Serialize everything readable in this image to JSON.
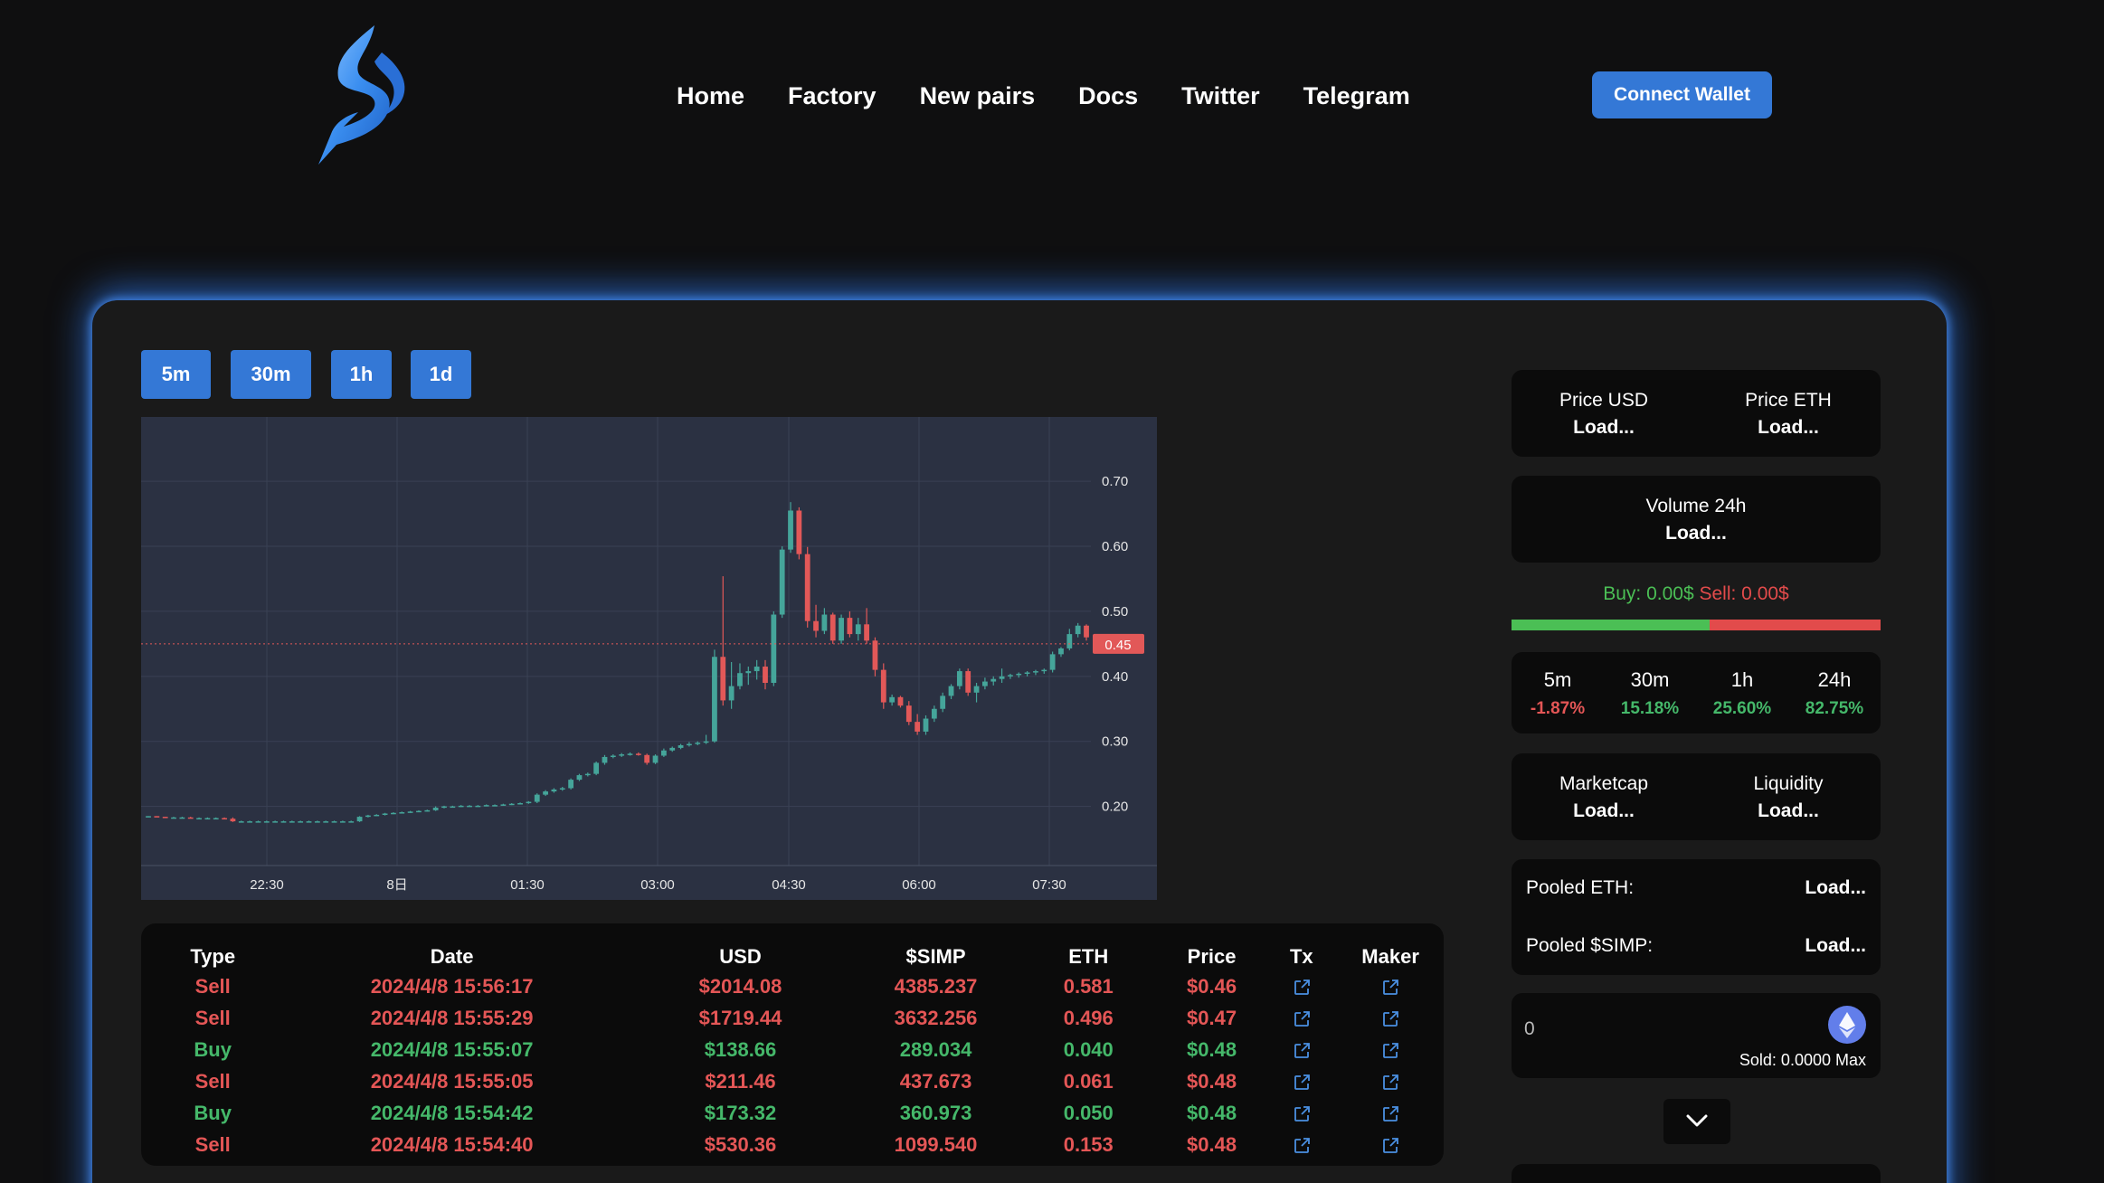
{
  "nav": {
    "items": [
      "Home",
      "Factory",
      "New pairs",
      "Docs",
      "Twitter",
      "Telegram"
    ],
    "connect_label": "Connect Wallet"
  },
  "timeframes": [
    "5m",
    "30m",
    "1h",
    "1d"
  ],
  "chart_data": {
    "type": "candlestick",
    "x_tick_labels": [
      "22:30",
      "8日",
      "01:30",
      "03:00",
      "04:30",
      "06:00",
      "07:30"
    ],
    "y_ticks": [
      0.2,
      0.3,
      0.4,
      0.5,
      0.6,
      0.7
    ],
    "y_tick_labels": [
      "0.20",
      "0.30",
      "0.40",
      "0.50",
      "0.60",
      "0.70"
    ],
    "ylim": [
      0.109,
      0.799
    ],
    "current_price": 0.45,
    "current_price_label": "0.45",
    "candles": [
      [
        0.185,
        0.185,
        0.184,
        0.185
      ],
      [
        0.185,
        0.185,
        0.184,
        0.184
      ],
      [
        0.184,
        0.184,
        0.183,
        0.183
      ],
      [
        0.183,
        0.184,
        0.182,
        0.183
      ],
      [
        0.183,
        0.184,
        0.182,
        0.183
      ],
      [
        0.183,
        0.184,
        0.182,
        0.182
      ],
      [
        0.182,
        0.183,
        0.181,
        0.182
      ],
      [
        0.182,
        0.183,
        0.181,
        0.182
      ],
      [
        0.182,
        0.183,
        0.181,
        0.182
      ],
      [
        0.182,
        0.183,
        0.181,
        0.181
      ],
      [
        0.181,
        0.183,
        0.176,
        0.177
      ],
      [
        0.177,
        0.178,
        0.176,
        0.177
      ],
      [
        0.177,
        0.178,
        0.176,
        0.177
      ],
      [
        0.177,
        0.178,
        0.176,
        0.177
      ],
      [
        0.177,
        0.178,
        0.176,
        0.177
      ],
      [
        0.177,
        0.178,
        0.176,
        0.177
      ],
      [
        0.177,
        0.178,
        0.176,
        0.177
      ],
      [
        0.177,
        0.178,
        0.176,
        0.177
      ],
      [
        0.177,
        0.178,
        0.176,
        0.177
      ],
      [
        0.177,
        0.178,
        0.176,
        0.177
      ],
      [
        0.177,
        0.178,
        0.176,
        0.177
      ],
      [
        0.177,
        0.178,
        0.176,
        0.177
      ],
      [
        0.177,
        0.178,
        0.176,
        0.177
      ],
      [
        0.177,
        0.178,
        0.176,
        0.177
      ],
      [
        0.177,
        0.178,
        0.176,
        0.177
      ],
      [
        0.177,
        0.185,
        0.176,
        0.184
      ],
      [
        0.184,
        0.187,
        0.183,
        0.186
      ],
      [
        0.186,
        0.188,
        0.185,
        0.187
      ],
      [
        0.187,
        0.19,
        0.186,
        0.189
      ],
      [
        0.189,
        0.191,
        0.188,
        0.19
      ],
      [
        0.19,
        0.192,
        0.189,
        0.191
      ],
      [
        0.191,
        0.193,
        0.19,
        0.192
      ],
      [
        0.192,
        0.194,
        0.191,
        0.193
      ],
      [
        0.193,
        0.195,
        0.192,
        0.194
      ],
      [
        0.194,
        0.2,
        0.193,
        0.198
      ],
      [
        0.198,
        0.201,
        0.197,
        0.2
      ],
      [
        0.2,
        0.201,
        0.199,
        0.2
      ],
      [
        0.2,
        0.202,
        0.199,
        0.201
      ],
      [
        0.201,
        0.202,
        0.2,
        0.201
      ],
      [
        0.201,
        0.202,
        0.2,
        0.201
      ],
      [
        0.201,
        0.203,
        0.2,
        0.202
      ],
      [
        0.202,
        0.203,
        0.201,
        0.202
      ],
      [
        0.202,
        0.204,
        0.201,
        0.203
      ],
      [
        0.203,
        0.205,
        0.202,
        0.204
      ],
      [
        0.204,
        0.206,
        0.203,
        0.205
      ],
      [
        0.205,
        0.208,
        0.204,
        0.207
      ],
      [
        0.207,
        0.22,
        0.205,
        0.218
      ],
      [
        0.218,
        0.225,
        0.216,
        0.223
      ],
      [
        0.223,
        0.228,
        0.221,
        0.226
      ],
      [
        0.226,
        0.23,
        0.224,
        0.228
      ],
      [
        0.228,
        0.243,
        0.226,
        0.241
      ],
      [
        0.241,
        0.25,
        0.239,
        0.248
      ],
      [
        0.248,
        0.252,
        0.246,
        0.25
      ],
      [
        0.25,
        0.269,
        0.248,
        0.267
      ],
      [
        0.267,
        0.279,
        0.264,
        0.276
      ],
      [
        0.276,
        0.28,
        0.274,
        0.278
      ],
      [
        0.278,
        0.282,
        0.276,
        0.28
      ],
      [
        0.28,
        0.283,
        0.278,
        0.281
      ],
      [
        0.281,
        0.283,
        0.278,
        0.279
      ],
      [
        0.279,
        0.281,
        0.264,
        0.267
      ],
      [
        0.267,
        0.28,
        0.265,
        0.278
      ],
      [
        0.278,
        0.289,
        0.276,
        0.286
      ],
      [
        0.286,
        0.292,
        0.284,
        0.29
      ],
      [
        0.29,
        0.296,
        0.288,
        0.294
      ],
      [
        0.294,
        0.299,
        0.292,
        0.296
      ],
      [
        0.296,
        0.3,
        0.294,
        0.298
      ],
      [
        0.298,
        0.31,
        0.296,
        0.3
      ],
      [
        0.3,
        0.441,
        0.298,
        0.43
      ],
      [
        0.43,
        0.554,
        0.355,
        0.363
      ],
      [
        0.363,
        0.422,
        0.35,
        0.385
      ],
      [
        0.385,
        0.42,
        0.38,
        0.405
      ],
      [
        0.405,
        0.415,
        0.387,
        0.408
      ],
      [
        0.408,
        0.425,
        0.395,
        0.415
      ],
      [
        0.415,
        0.425,
        0.38,
        0.39
      ],
      [
        0.39,
        0.5,
        0.385,
        0.495
      ],
      [
        0.495,
        0.6,
        0.49,
        0.595
      ],
      [
        0.595,
        0.668,
        0.59,
        0.655
      ],
      [
        0.655,
        0.66,
        0.58,
        0.588
      ],
      [
        0.588,
        0.599,
        0.475,
        0.485
      ],
      [
        0.485,
        0.51,
        0.46,
        0.47
      ],
      [
        0.47,
        0.505,
        0.465,
        0.495
      ],
      [
        0.495,
        0.498,
        0.45,
        0.455
      ],
      [
        0.455,
        0.495,
        0.45,
        0.49
      ],
      [
        0.49,
        0.5,
        0.46,
        0.465
      ],
      [
        0.465,
        0.49,
        0.455,
        0.48
      ],
      [
        0.48,
        0.505,
        0.45,
        0.455
      ],
      [
        0.455,
        0.46,
        0.4,
        0.41
      ],
      [
        0.41,
        0.42,
        0.35,
        0.36
      ],
      [
        0.36,
        0.372,
        0.355,
        0.368
      ],
      [
        0.368,
        0.37,
        0.352,
        0.355
      ],
      [
        0.355,
        0.362,
        0.325,
        0.33
      ],
      [
        0.33,
        0.342,
        0.31,
        0.315
      ],
      [
        0.315,
        0.34,
        0.31,
        0.335
      ],
      [
        0.335,
        0.355,
        0.33,
        0.35
      ],
      [
        0.35,
        0.375,
        0.345,
        0.37
      ],
      [
        0.37,
        0.388,
        0.365,
        0.385
      ],
      [
        0.385,
        0.412,
        0.38,
        0.408
      ],
      [
        0.408,
        0.412,
        0.37,
        0.375
      ],
      [
        0.375,
        0.39,
        0.36,
        0.385
      ],
      [
        0.385,
        0.398,
        0.38,
        0.392
      ],
      [
        0.392,
        0.4,
        0.386,
        0.396
      ],
      [
        0.396,
        0.412,
        0.39,
        0.4
      ],
      [
        0.4,
        0.404,
        0.396,
        0.402
      ],
      [
        0.402,
        0.406,
        0.398,
        0.404
      ],
      [
        0.404,
        0.408,
        0.4,
        0.406
      ],
      [
        0.406,
        0.41,
        0.402,
        0.408
      ],
      [
        0.408,
        0.412,
        0.404,
        0.41
      ],
      [
        0.41,
        0.438,
        0.406,
        0.434
      ],
      [
        0.434,
        0.445,
        0.43,
        0.443
      ],
      [
        0.443,
        0.473,
        0.44,
        0.465
      ],
      [
        0.465,
        0.482,
        0.46,
        0.478
      ],
      [
        0.478,
        0.48,
        0.455,
        0.46
      ]
    ]
  },
  "trades": {
    "headers": [
      "Type",
      "Date",
      "USD",
      "$SIMP",
      "ETH",
      "Price",
      "Tx",
      "Maker"
    ],
    "rows": [
      {
        "type": "Sell",
        "date": "2024/4/8 15:56:17",
        "usd": "$2014.08",
        "simp": "4385.237",
        "eth": "0.581",
        "price": "$0.46"
      },
      {
        "type": "Sell",
        "date": "2024/4/8 15:55:29",
        "usd": "$1719.44",
        "simp": "3632.256",
        "eth": "0.496",
        "price": "$0.47"
      },
      {
        "type": "Buy",
        "date": "2024/4/8 15:55:07",
        "usd": "$138.66",
        "simp": "289.034",
        "eth": "0.040",
        "price": "$0.48"
      },
      {
        "type": "Sell",
        "date": "2024/4/8 15:55:05",
        "usd": "$211.46",
        "simp": "437.673",
        "eth": "0.061",
        "price": "$0.48"
      },
      {
        "type": "Buy",
        "date": "2024/4/8 15:54:42",
        "usd": "$173.32",
        "simp": "360.973",
        "eth": "0.050",
        "price": "$0.48"
      },
      {
        "type": "Sell",
        "date": "2024/4/8 15:54:40",
        "usd": "$530.36",
        "simp": "1099.540",
        "eth": "0.153",
        "price": "$0.48"
      }
    ]
  },
  "stats": {
    "price_usd_label": "Price USD",
    "price_usd_value": "Load...",
    "price_eth_label": "Price ETH",
    "price_eth_value": "Load...",
    "volume_label": "Volume 24h",
    "volume_value": "Load...",
    "buy_text": "Buy: 0.00$",
    "sell_text": "Sell: 0.00$",
    "buy_ratio": 0.537,
    "changes": [
      {
        "label": "5m",
        "value": "-1.87%",
        "sign": "neg"
      },
      {
        "label": "30m",
        "value": "15.18%",
        "sign": "pos"
      },
      {
        "label": "1h",
        "value": "25.60%",
        "sign": "pos"
      },
      {
        "label": "24h",
        "value": "82.75%",
        "sign": "pos"
      }
    ],
    "marketcap_label": "Marketcap",
    "marketcap_value": "Load...",
    "liquidity_label": "Liquidity",
    "liquidity_value": "Load...",
    "pooled_eth_label": "Pooled ETH:",
    "pooled_eth_value": "Load...",
    "pooled_simp_label": "Pooled $SIMP:",
    "pooled_simp_value": "Load..."
  },
  "swap": {
    "input_value": "0",
    "sold_text": "Sold: 0.0000 Max"
  },
  "colors": {
    "accent": "#3478d6",
    "buy": "#45b86a",
    "sell": "#e45656",
    "chart_bg": "#2b3142"
  }
}
